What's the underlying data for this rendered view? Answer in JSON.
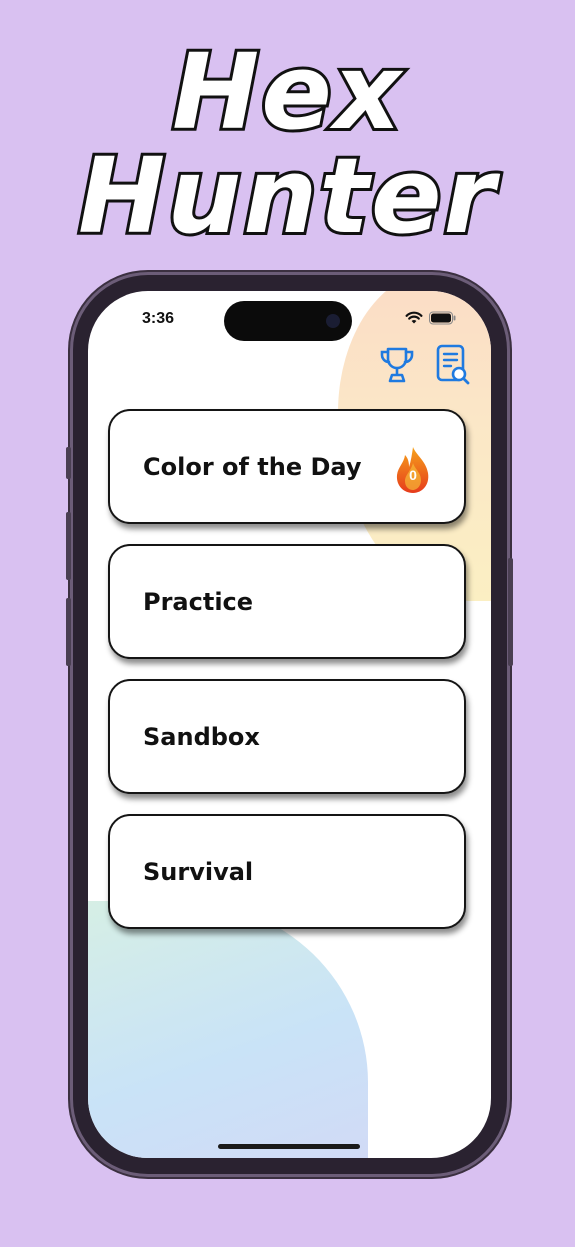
{
  "app": {
    "title": "Hex Hunter"
  },
  "status_bar": {
    "time": "3:36",
    "icons": [
      "wifi-icon",
      "battery-icon"
    ]
  },
  "toolbar": {
    "icons": [
      "trophy-icon",
      "document-search-icon"
    ]
  },
  "modes": [
    {
      "label": "Color of the Day",
      "streak": "0",
      "icon": "flame-icon"
    },
    {
      "label": "Practice"
    },
    {
      "label": "Sandbox"
    },
    {
      "label": "Survival"
    }
  ],
  "colors": {
    "background": "#d9c1f1",
    "accent": "#1f7ae0",
    "card_border": "#151515",
    "flame_top": "#f6a21b",
    "flame_bottom": "#e63b1c"
  }
}
